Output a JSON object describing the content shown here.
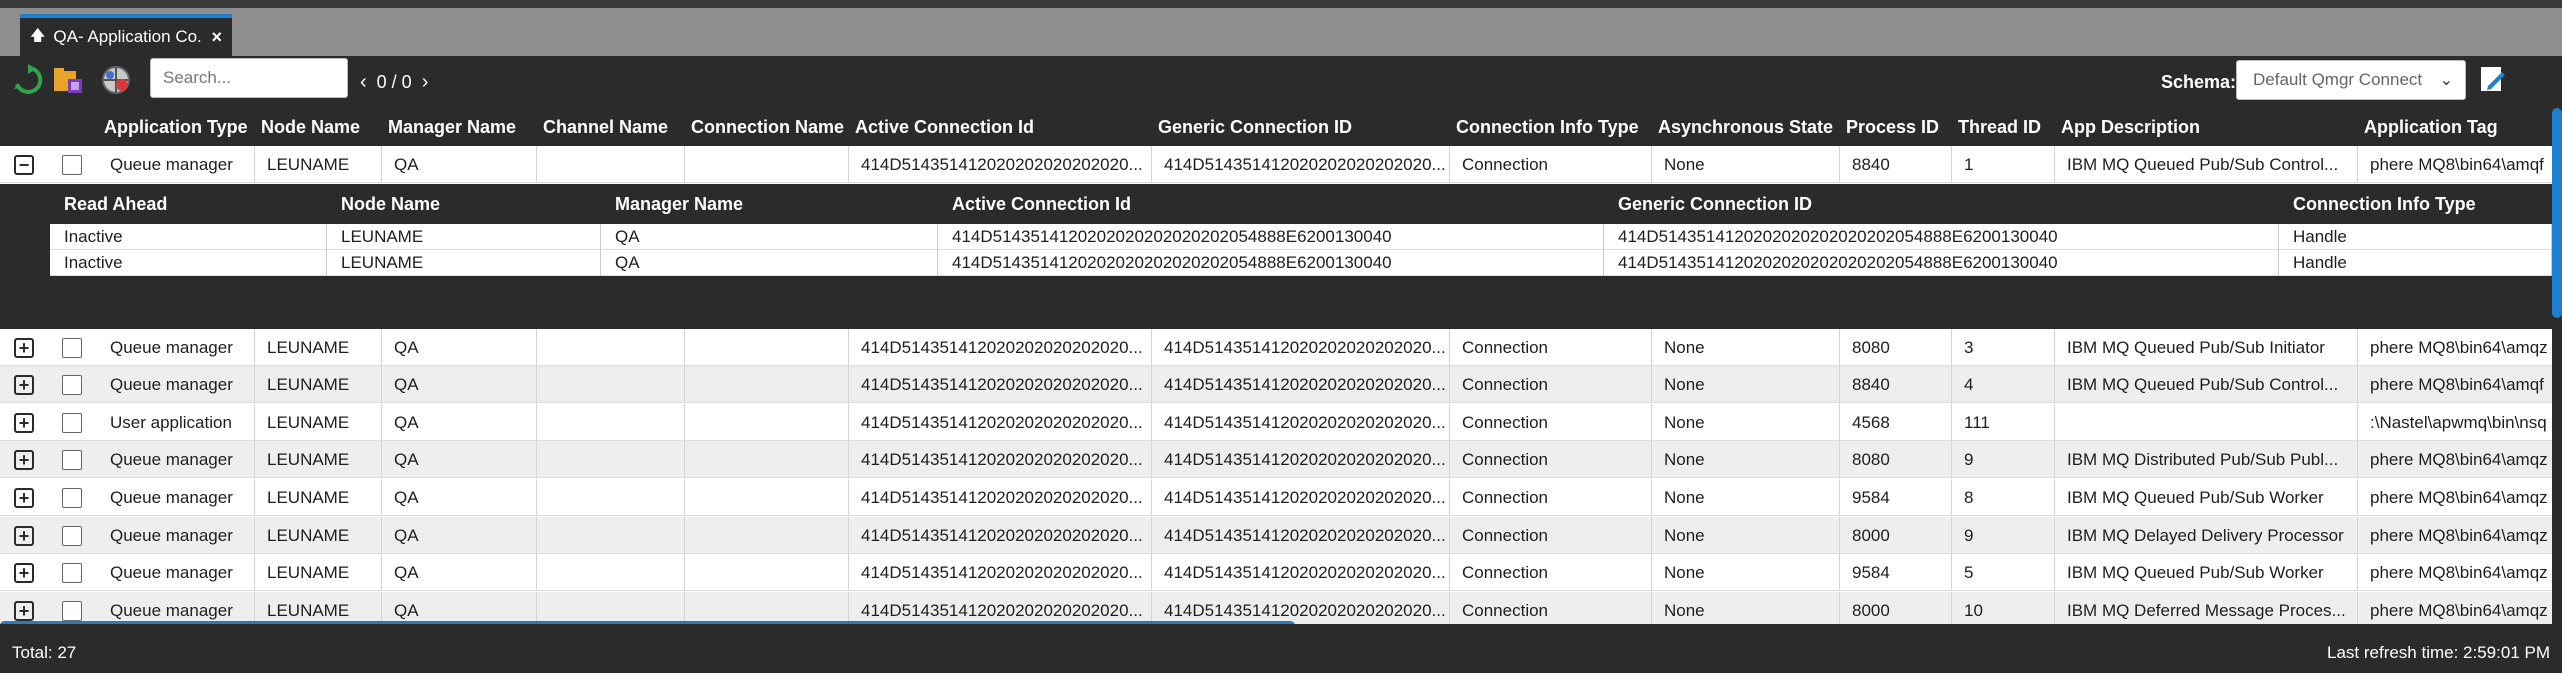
{
  "tab": {
    "label": "QA- Application Co...",
    "icon": "up-arrow-icon",
    "close": "×"
  },
  "toolbar": {
    "search_placeholder": "Search...",
    "pager_text": "0 / 0",
    "schema_label": "Schema:",
    "schema_value": "Default Qmgr Connect"
  },
  "columns": [
    "Application Type",
    "Node Name",
    "Manager Name",
    "Channel Name",
    "Connection Name",
    "Active Connection Id",
    "Generic Connection ID",
    "Connection Info Type",
    "Asynchronous State",
    "Process ID",
    "Thread ID",
    "App Description",
    "Application Tag"
  ],
  "rows": [
    [
      "Queue manager",
      "LEUNAME",
      "QA",
      "",
      "",
      "414D514351412020202020202020...",
      "414D514351412020202020202020...",
      "Connection",
      "None",
      "8840",
      "1",
      "IBM MQ Queued Pub/Sub Control...",
      "phere MQ8\\bin64\\amqf"
    ],
    [
      "Queue manager",
      "LEUNAME",
      "QA",
      "",
      "",
      "414D514351412020202020202020...",
      "414D514351412020202020202020...",
      "Connection",
      "None",
      "8080",
      "3",
      "IBM MQ Queued Pub/Sub Initiator",
      "phere MQ8\\bin64\\amqz"
    ],
    [
      "Queue manager",
      "LEUNAME",
      "QA",
      "",
      "",
      "414D514351412020202020202020...",
      "414D514351412020202020202020...",
      "Connection",
      "None",
      "8840",
      "4",
      "IBM MQ Queued Pub/Sub Control...",
      "phere MQ8\\bin64\\amqf"
    ],
    [
      "User application",
      "LEUNAME",
      "QA",
      "",
      "",
      "414D514351412020202020202020...",
      "414D514351412020202020202020...",
      "Connection",
      "None",
      "4568",
      "111",
      "",
      ":\\Nastel\\apwmq\\bin\\nsq"
    ],
    [
      "Queue manager",
      "LEUNAME",
      "QA",
      "",
      "",
      "414D514351412020202020202020...",
      "414D514351412020202020202020...",
      "Connection",
      "None",
      "8080",
      "9",
      "IBM MQ Distributed Pub/Sub Publ...",
      "phere MQ8\\bin64\\amqz"
    ],
    [
      "Queue manager",
      "LEUNAME",
      "QA",
      "",
      "",
      "414D514351412020202020202020...",
      "414D514351412020202020202020...",
      "Connection",
      "None",
      "9584",
      "8",
      "IBM MQ Queued Pub/Sub Worker",
      "phere MQ8\\bin64\\amqz"
    ],
    [
      "Queue manager",
      "LEUNAME",
      "QA",
      "",
      "",
      "414D514351412020202020202020...",
      "414D514351412020202020202020...",
      "Connection",
      "None",
      "8000",
      "9",
      "IBM MQ Delayed Delivery Processor",
      "phere MQ8\\bin64\\amqz"
    ],
    [
      "Queue manager",
      "LEUNAME",
      "QA",
      "",
      "",
      "414D514351412020202020202020...",
      "414D514351412020202020202020...",
      "Connection",
      "None",
      "9584",
      "5",
      "IBM MQ Queued Pub/Sub Worker",
      "phere MQ8\\bin64\\amqz"
    ],
    [
      "Queue manager",
      "LEUNAME",
      "QA",
      "",
      "",
      "414D514351412020202020202020...",
      "414D514351412020202020202020...",
      "Connection",
      "None",
      "8000",
      "10",
      "IBM MQ Deferred Message Proces...",
      "phere MQ8\\bin64\\amqz"
    ]
  ],
  "detail": {
    "columns": [
      "Read Ahead",
      "Node Name",
      "Manager Name",
      "Active Connection Id",
      "Generic Connection ID",
      "Connection Info Type"
    ],
    "rows": [
      [
        "Inactive",
        "LEUNAME",
        "QA",
        "414D5143514120202020202020202054888E6200130040",
        "414D5143514120202020202020202054888E6200130040",
        "Handle"
      ],
      [
        "Inactive",
        "LEUNAME",
        "QA",
        "414D5143514120202020202020202054888E6200130040",
        "414D5143514120202020202020202054888E6200130040",
        "Handle"
      ]
    ]
  },
  "footer": {
    "total": "Total: 27",
    "refresh": "Last refresh time: 2:59:01 PM"
  },
  "icons": [
    "refresh-icon",
    "folder-icon",
    "globe-settings-icon",
    "edit-icon"
  ],
  "accent_color": "#1d7fd0"
}
